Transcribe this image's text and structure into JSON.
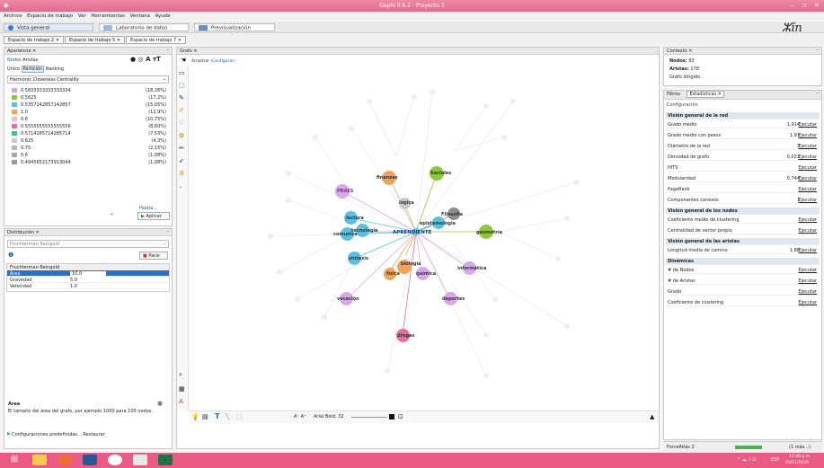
{
  "window": {
    "title": "Gephi 0.9.2 - Proyecto 1",
    "min": "–",
    "max": "▫",
    "close": "✕"
  },
  "menu": [
    "Archivo",
    "Espacio de trabajo",
    "Ver",
    "Herramientas",
    "Ventana",
    "Ayude"
  ],
  "main_tabs": [
    "Vista general",
    "Laboratorio de datos",
    "Previsualización"
  ],
  "workspaces": [
    "Espacio de trabajo 2 ✕",
    "Espacio de trabajo 5 ✕",
    "Espacio de trabajo 7 ✕"
  ],
  "appearance": {
    "title": "Apariencia ✕",
    "modes": [
      "Nodos",
      "Aristas"
    ],
    "subtabs": [
      "Único",
      "Partición",
      "Ranking"
    ],
    "attribute": "Harmonic Closeness Centrality",
    "items": [
      {
        "label": "0.5833333333333334",
        "pct": "(18,26%)",
        "color": "#d6a8e6"
      },
      {
        "label": "0.5625",
        "pct": "(17,2%)",
        "color": "#8fc63f"
      },
      {
        "label": "0.5357142857142857",
        "pct": "(15,05%)",
        "color": "#5bc0de"
      },
      {
        "label": "1.0",
        "pct": "(12,9%)",
        "color": "#f0a35b"
      },
      {
        "label": "0.6",
        "pct": "(10,75%)",
        "color": "#e8c0c4"
      },
      {
        "label": "0.5555555555555556",
        "pct": "(8,60%)",
        "color": "#e86aa0"
      },
      {
        "label": "0.5714285714285714",
        "pct": "(7,53%)",
        "color": "#3fbf9f"
      },
      {
        "label": "0.625",
        "pct": "(4,3%)",
        "color": "#c9c9c9"
      },
      {
        "label": "0.75",
        "pct": "(2,15%)",
        "color": "#b8b8b8"
      },
      {
        "label": "0.6",
        "pct": "(1,08%)",
        "color": "#a9a9a9"
      },
      {
        "label": "0.4945652173913044",
        "pct": "(1,08%)",
        "color": "#9a9a9a"
      }
    ],
    "palette": "Paleta...",
    "apply": "Aplicar"
  },
  "layout": {
    "title": "Distribución ✕",
    "algorithm": "Fruchterman Reingold",
    "stop": "Parar",
    "section": "Fruchterman Reingold",
    "props": [
      {
        "k": "Área",
        "v": "10.0"
      },
      {
        "k": "Gravedad",
        "v": "5.0"
      },
      {
        "k": "Velocidad",
        "v": "1.0"
      }
    ],
    "desc_title": "Área",
    "desc": "El tamaño del área del grafo, por ejemplo 1000 para 100 nodos.",
    "presets": "Configuraciones predefinidas...",
    "reset": "Restaurar"
  },
  "graph": {
    "title": "Grafo ✕",
    "toolbar_label": "Arrastrar",
    "config": "(Configurar)",
    "font": "Arial Bold, 32"
  },
  "context": {
    "title": "Contexto ✕",
    "nodes_k": "Nodos:",
    "nodes_v": "93",
    "edges_k": "Aristas:",
    "edges_v": "178",
    "type": "Grafo dirigido"
  },
  "stats": {
    "tabs": [
      "Filtros",
      "Estadísticas ✕"
    ],
    "config": "Configuración",
    "rows": [
      {
        "k": "Visión general de la red",
        "section": true
      },
      {
        "k": "Grado medio",
        "v": "1,914",
        "e": "Ejecutar"
      },
      {
        "k": "Grado medio con pesos",
        "v": "1,91",
        "e": "Ejecutar"
      },
      {
        "k": "Diámetro de la red",
        "v": "3",
        "e": "Ejecutar"
      },
      {
        "k": "Densidad de grafo",
        "v": "0,021",
        "e": "Ejecutar"
      },
      {
        "k": "HITS",
        "v": "",
        "e": "Ejecutar"
      },
      {
        "k": "Modularidad",
        "v": "0,744",
        "e": "Ejecutar"
      },
      {
        "k": "PageRank",
        "v": "",
        "e": "Ejecutar"
      },
      {
        "k": "Componentes conexos",
        "v": "1",
        "e": "Ejecutar"
      },
      {
        "k": "Visión general de los nodos",
        "section": true
      },
      {
        "k": "Coeficiente medio de clustering",
        "v": "",
        "e": "Ejecutar"
      },
      {
        "k": "Centralidad de vector propio",
        "v": "",
        "e": "Ejecutar"
      },
      {
        "k": "Visión general de las aristas",
        "section": true
      },
      {
        "k": "Longitud media de camino",
        "v": "1,88",
        "e": "Ejecutar"
      },
      {
        "k": "Dinámicas",
        "section": true
      },
      {
        "k": "# de Nodos",
        "v": "",
        "e": "Ejecutar"
      },
      {
        "k": "# de Aristas",
        "v": "",
        "e": "Ejecutar"
      },
      {
        "k": "Grado",
        "v": "",
        "e": "Ejecutar"
      },
      {
        "k": "Coeficiente de clustering",
        "v": "",
        "e": "Ejecutar"
      }
    ]
  },
  "statusbar": {
    "left": "ForceAtlas 2",
    "right": "(1 más...)"
  },
  "taskbar": {
    "lang": "ESP",
    "time": "12:48 p.m.",
    "date": "20/11/2020"
  },
  "nodes": [
    {
      "label": "APRENDIENTE",
      "color": "#5bc0de"
    },
    {
      "label": "finanzas",
      "color": "#f0a35b"
    },
    {
      "label": "Sociales",
      "color": "#8fc63f"
    },
    {
      "label": "PRAES",
      "color": "#d6a8e6"
    },
    {
      "label": "lógica",
      "color": "#c9c9c9"
    },
    {
      "label": "Filosofía",
      "color": "#8c8c8c"
    },
    {
      "label": "epistemología",
      "color": "#5bc0de"
    },
    {
      "label": "geometría",
      "color": "#8fc63f"
    },
    {
      "label": "lectura",
      "color": "#5bc0de"
    },
    {
      "label": "comunicación",
      "color": "#5bc0de"
    },
    {
      "label": "tecnología",
      "color": "#5bc0de"
    },
    {
      "label": "sintaxis",
      "color": "#5bc0de"
    },
    {
      "label": "biología",
      "color": "#f0a35b"
    },
    {
      "label": "física",
      "color": "#f0a35b"
    },
    {
      "label": "química",
      "color": "#d6a8e6"
    },
    {
      "label": "informática",
      "color": "#d6a8e6"
    },
    {
      "label": "vocación",
      "color": "#d6a8e6"
    },
    {
      "label": "deportes",
      "color": "#d6a8e6"
    },
    {
      "label": "drogas",
      "color": "#e86aa0"
    }
  ]
}
